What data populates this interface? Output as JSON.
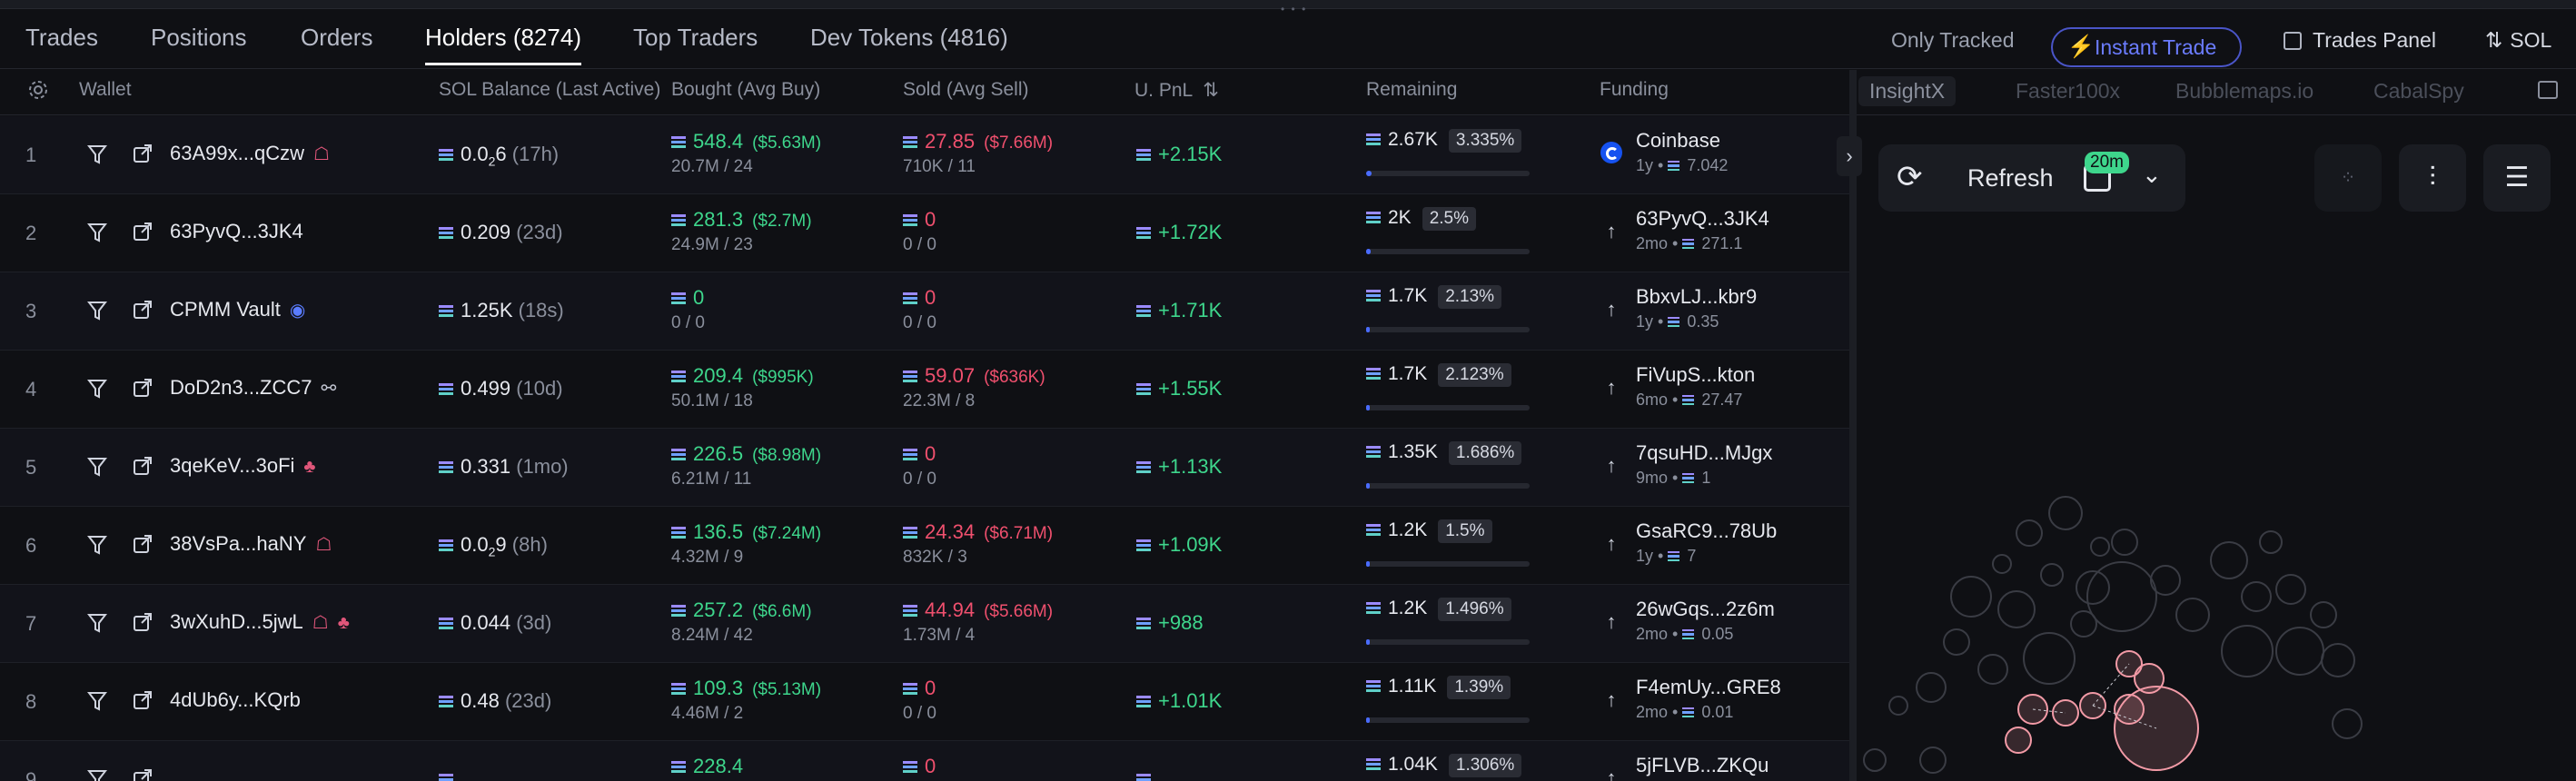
{
  "tabs": [
    {
      "label": "Trades"
    },
    {
      "label": "Positions"
    },
    {
      "label": "Orders"
    },
    {
      "label": "Holders (8274)"
    },
    {
      "label": "Top Traders"
    },
    {
      "label": "Dev Tokens (4816)"
    }
  ],
  "toolbar": {
    "only_tracked": "Only Tracked",
    "instant_trade": "Instant Trade",
    "trades_panel": "Trades Panel",
    "currency": "SOL"
  },
  "columns": {
    "wallet": "Wallet",
    "sol_balance": "SOL Balance (Last Active)",
    "bought": "Bought (Avg Buy)",
    "sold": "Sold (Avg Sell)",
    "pnl": "U. PnL",
    "remaining": "Remaining",
    "funding": "Funding"
  },
  "rows": [
    {
      "idx": "1",
      "wallet": "63A99x...qCzw",
      "bal_a": "0.0",
      "bal_sub": "2",
      "bal_b": "6",
      "bal_age": "(17h)",
      "bought": "548.4",
      "bought_usd": "($5.63M)",
      "bought_sub": "20.7M / 24",
      "sold": "27.85",
      "sold_usd": "($7.66M)",
      "sold_sub": "710K / 11",
      "pnl": "+2.15K",
      "rem": "2.67K",
      "rem_pct": "3.335%",
      "rem_frac": 0.033,
      "fund_name": "Coinbase",
      "fund_age": "1y",
      "fund_amt": "7.042"
    },
    {
      "idx": "2",
      "wallet": "63PyvQ...3JK4",
      "bal_a": "0.209",
      "bal_sub": "",
      "bal_b": "",
      "bal_age": "(23d)",
      "bought": "281.3",
      "bought_usd": "($2.7M)",
      "bought_sub": "24.9M / 23",
      "sold": "0",
      "sold_usd": "",
      "sold_sub": "0 / 0",
      "pnl": "+1.72K",
      "rem": "2K",
      "rem_pct": "2.5%",
      "rem_frac": 0.025,
      "fund_name": "63PyvQ...3JK4",
      "fund_age": "2mo",
      "fund_amt": "271.1"
    },
    {
      "idx": "3",
      "wallet": "CPMM Vault",
      "bal_a": "1.25K",
      "bal_sub": "",
      "bal_b": "",
      "bal_age": "(18s)",
      "bought": "0",
      "bought_usd": "",
      "bought_sub": "0 / 0",
      "sold": "0",
      "sold_usd": "",
      "sold_sub": "0 / 0",
      "pnl": "+1.71K",
      "rem": "1.7K",
      "rem_pct": "2.13%",
      "rem_frac": 0.021,
      "fund_name": "BbxvLJ...kbr9",
      "fund_age": "1y",
      "fund_amt": "0.35"
    },
    {
      "idx": "4",
      "wallet": "DoD2n3...ZCC7",
      "bal_a": "0.499",
      "bal_sub": "",
      "bal_b": "",
      "bal_age": "(10d)",
      "bought": "209.4",
      "bought_usd": "($995K)",
      "bought_sub": "50.1M / 18",
      "sold": "59.07",
      "sold_usd": "($636K)",
      "sold_sub": "22.3M / 8",
      "pnl": "+1.55K",
      "rem": "1.7K",
      "rem_pct": "2.123%",
      "rem_frac": 0.021,
      "fund_name": "FiVupS...kton",
      "fund_age": "6mo",
      "fund_amt": "27.47"
    },
    {
      "idx": "5",
      "wallet": "3qeKeV...3oFi",
      "bal_a": "0.331",
      "bal_sub": "",
      "bal_b": "",
      "bal_age": "(1mo)",
      "bought": "226.5",
      "bought_usd": "($8.98M)",
      "bought_sub": "6.21M / 11",
      "sold": "0",
      "sold_usd": "",
      "sold_sub": "0 / 0",
      "pnl": "+1.13K",
      "rem": "1.35K",
      "rem_pct": "1.686%",
      "rem_frac": 0.017,
      "fund_name": "7qsuHD...MJgx",
      "fund_age": "9mo",
      "fund_amt": "1"
    },
    {
      "idx": "6",
      "wallet": "38VsPa...haNY",
      "bal_a": "0.0",
      "bal_sub": "2",
      "bal_b": "9",
      "bal_age": "(8h)",
      "bought": "136.5",
      "bought_usd": "($7.24M)",
      "bought_sub": "4.32M / 9",
      "sold": "24.34",
      "sold_usd": "($6.71M)",
      "sold_sub": "832K / 3",
      "pnl": "+1.09K",
      "rem": "1.2K",
      "rem_pct": "1.5%",
      "rem_frac": 0.015,
      "fund_name": "GsaRC9...78Ub",
      "fund_age": "1y",
      "fund_amt": "7"
    },
    {
      "idx": "7",
      "wallet": "3wXuhD...5jwL",
      "bal_a": "0.044",
      "bal_sub": "",
      "bal_b": "",
      "bal_age": "(3d)",
      "bought": "257.2",
      "bought_usd": "($6.6M)",
      "bought_sub": "8.24M / 42",
      "sold": "44.94",
      "sold_usd": "($5.66M)",
      "sold_sub": "1.73M / 4",
      "pnl": "+988",
      "rem": "1.2K",
      "rem_pct": "1.496%",
      "rem_frac": 0.015,
      "fund_name": "26wGqs...2z6m",
      "fund_age": "2mo",
      "fund_amt": "0.05"
    },
    {
      "idx": "8",
      "wallet": "4dUb6y...KQrb",
      "bal_a": "0.48",
      "bal_sub": "",
      "bal_b": "",
      "bal_age": "(23d)",
      "bought": "109.3",
      "bought_usd": "($5.13M)",
      "bought_sub": "4.46M / 2",
      "sold": "0",
      "sold_usd": "",
      "sold_sub": "0 / 0",
      "pnl": "+1.01K",
      "rem": "1.11K",
      "rem_pct": "1.39%",
      "rem_frac": 0.014,
      "fund_name": "F4emUy...GRE8",
      "fund_age": "2mo",
      "fund_amt": "0.01"
    },
    {
      "idx": "9",
      "wallet": "",
      "bal_a": "",
      "bal_sub": "",
      "bal_b": "",
      "bal_age": "",
      "bought": "228.4",
      "bought_usd": "",
      "bought_sub": "",
      "sold": "0",
      "sold_usd": "",
      "sold_sub": "",
      "pnl": "",
      "rem": "1.04K",
      "rem_pct": "1.306%",
      "rem_frac": 0.013,
      "fund_name": "5jFLVB...ZKQu",
      "fund_age": "",
      "fund_amt": ""
    }
  ],
  "right_tabs": [
    {
      "label": "InsightX"
    },
    {
      "label": "Faster100x"
    },
    {
      "label": "Bubblemaps.io"
    },
    {
      "label": "CabalSpy"
    }
  ],
  "insight": {
    "refresh_label": "Refresh",
    "badge": "20m"
  },
  "colors": {
    "accent": "#6b7cff",
    "positive": "#3ed68c",
    "negative": "#f0506e",
    "background": "#0f1014"
  }
}
